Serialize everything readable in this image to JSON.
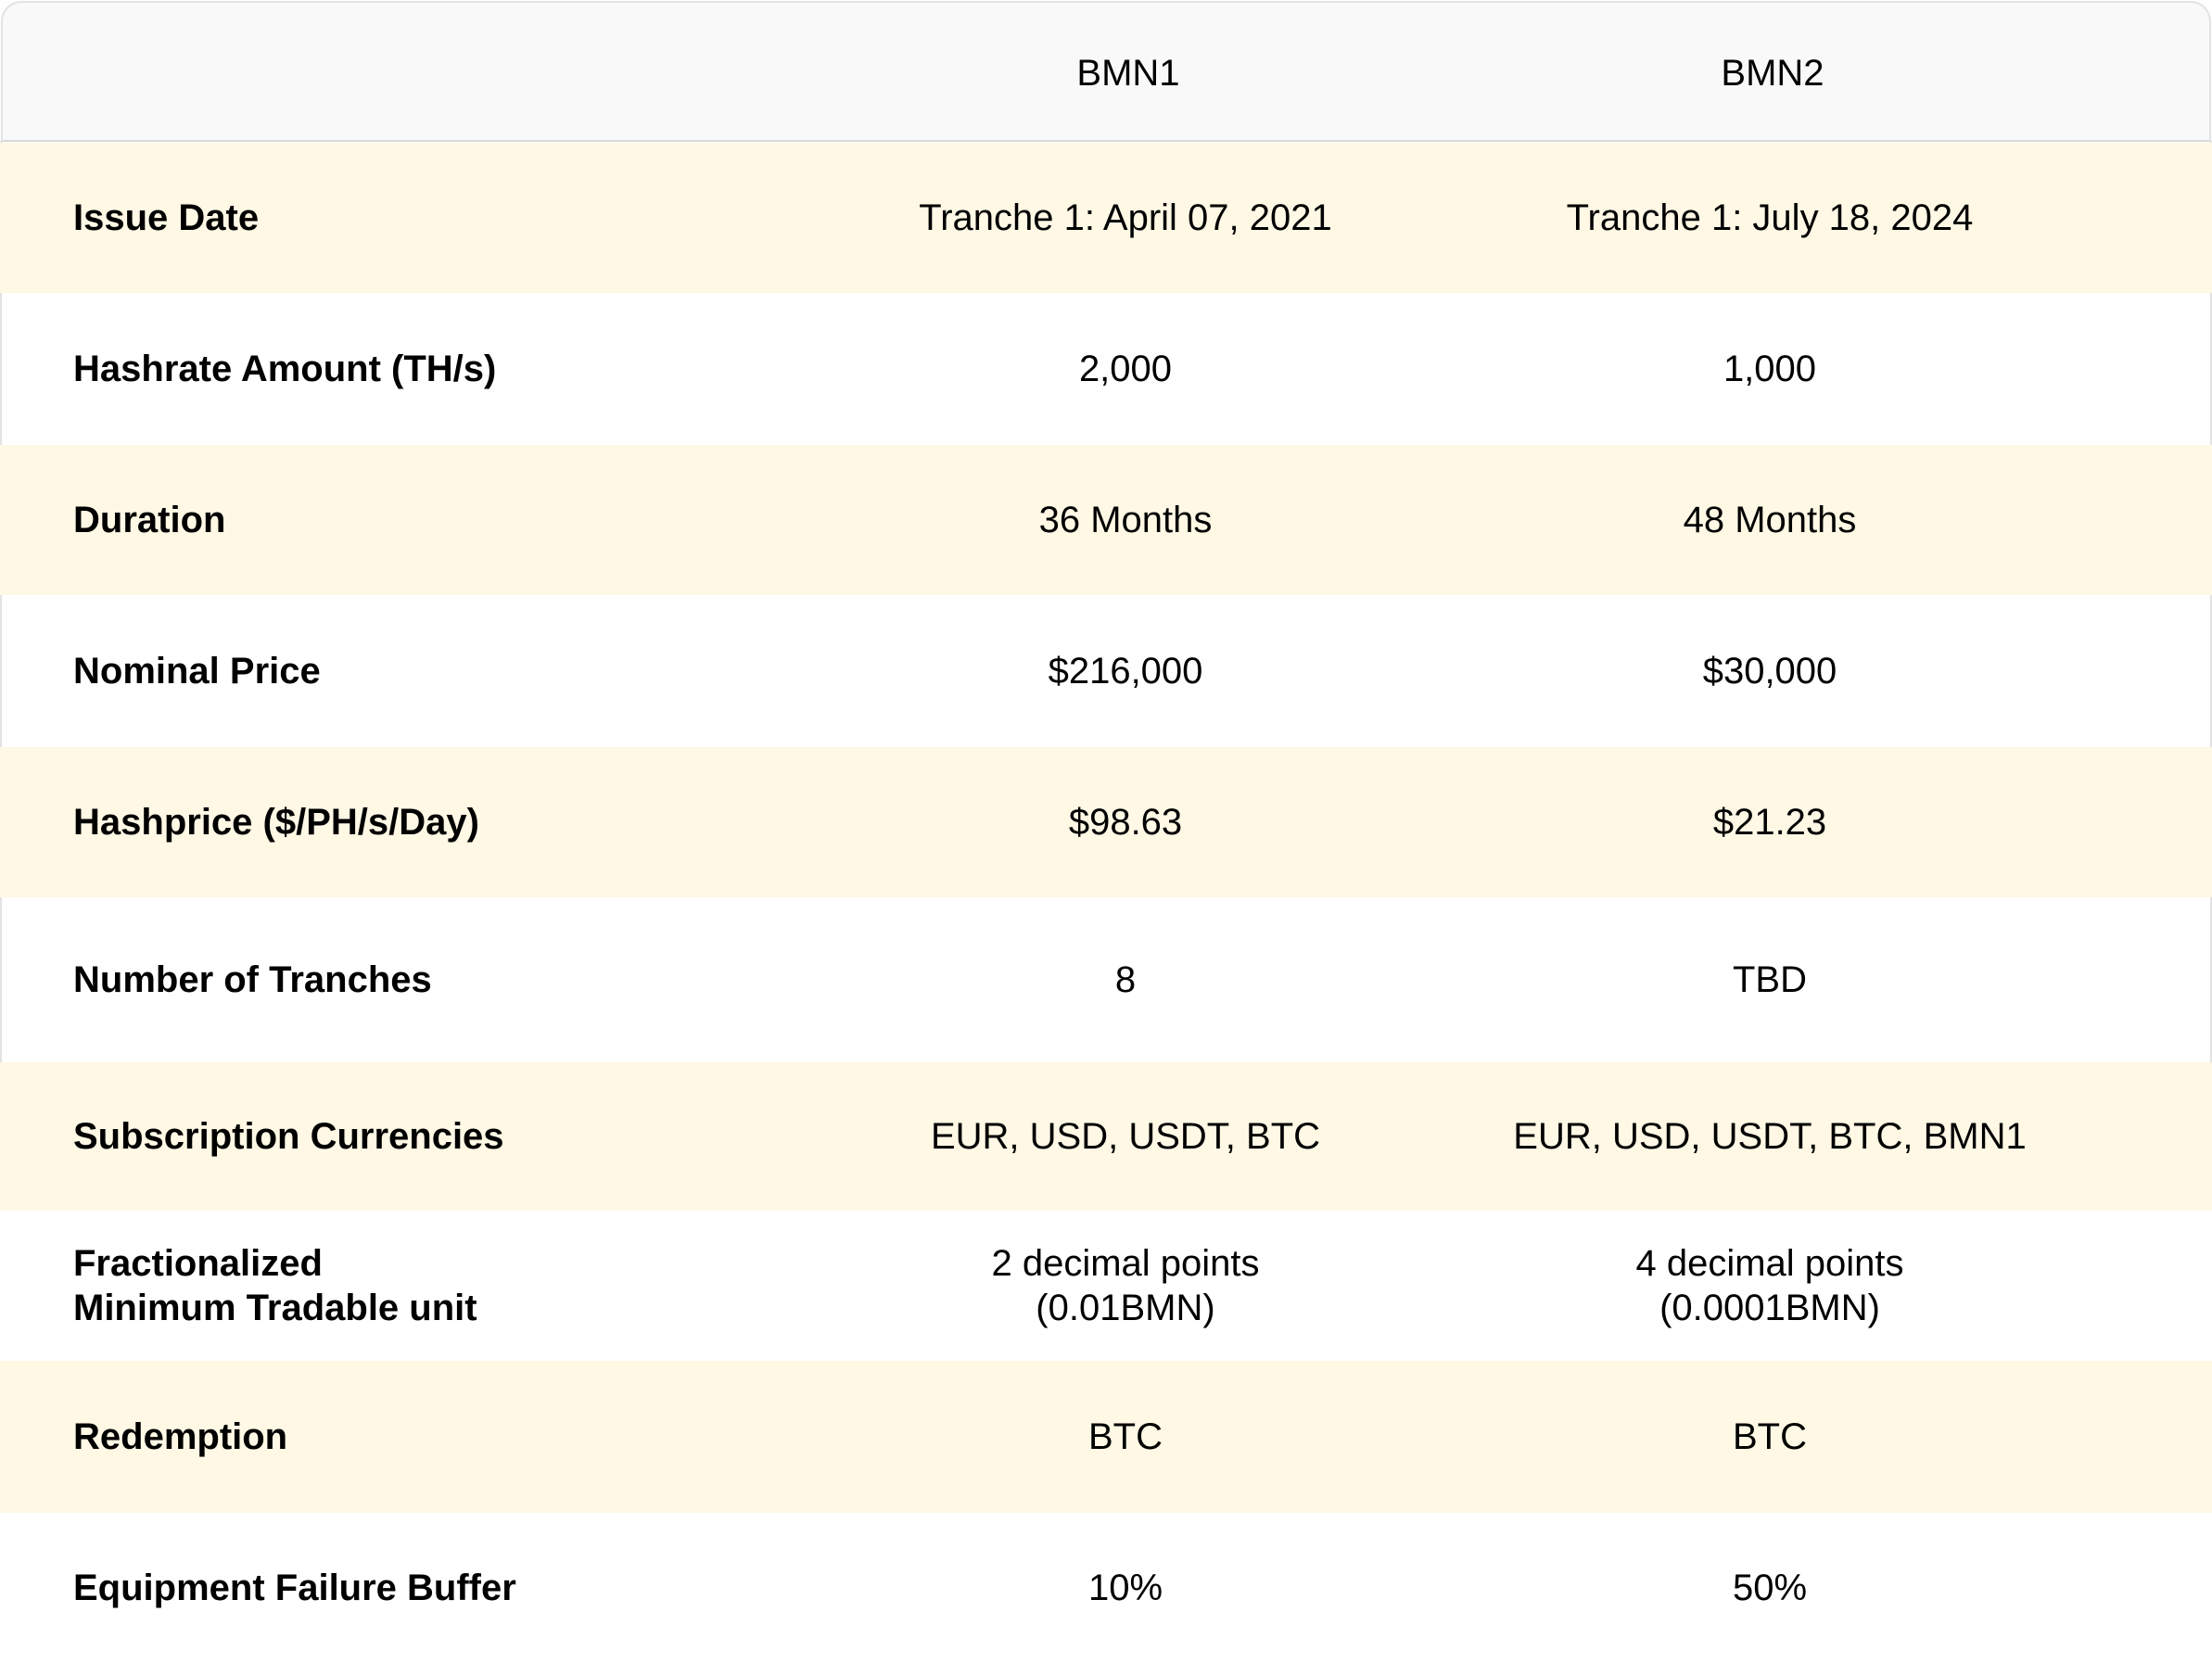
{
  "table": {
    "columns": [
      "",
      "BMN1",
      "BMN2"
    ],
    "rows": [
      {
        "label": [
          "Issue Date"
        ],
        "bmn1": [
          "Tranche 1: April 07, 2021"
        ],
        "bmn2": [
          "Tranche 1: July 18, 2024"
        ],
        "shaded": true
      },
      {
        "label": [
          "Hashrate Amount (TH/s)"
        ],
        "bmn1": [
          "2,000"
        ],
        "bmn2": [
          "1,000"
        ],
        "shaded": false
      },
      {
        "label": [
          "Duration"
        ],
        "bmn1": [
          "36 Months"
        ],
        "bmn2": [
          "48 Months"
        ],
        "shaded": true
      },
      {
        "label": [
          "Nominal Price"
        ],
        "bmn1": [
          "$216,000"
        ],
        "bmn2": [
          "$30,000"
        ],
        "shaded": false
      },
      {
        "label": [
          "Hashprice ($/PH/s/Day)"
        ],
        "bmn1": [
          "$98.63"
        ],
        "bmn2": [
          "$21.23"
        ],
        "shaded": true
      },
      {
        "label": [
          "Number of Tranches"
        ],
        "bmn1": [
          "8"
        ],
        "bmn2": [
          "TBD"
        ],
        "shaded": false
      },
      {
        "label": [
          "Subscription Currencies"
        ],
        "bmn1": [
          "EUR, USD, USDT, BTC"
        ],
        "bmn2": [
          "EUR, USD, USDT, BTC, BMN1"
        ],
        "shaded": true
      },
      {
        "label": [
          "Fractionalized",
          "Minimum Tradable unit"
        ],
        "bmn1": [
          "2 decimal points",
          "(0.01BMN)"
        ],
        "bmn2": [
          "4 decimal points",
          "(0.0001BMN)"
        ],
        "shaded": false
      },
      {
        "label": [
          "Redemption"
        ],
        "bmn1": [
          "BTC"
        ],
        "bmn2": [
          "BTC"
        ],
        "shaded": true
      },
      {
        "label": [
          "Equipment Failure Buffer"
        ],
        "bmn1": [
          "10%"
        ],
        "bmn2": [
          "50%"
        ],
        "shaded": false
      }
    ]
  },
  "colors": {
    "header_bg": "#f9f9f9",
    "shaded_row": "#fef8e5",
    "border": "#e3e3e3"
  }
}
